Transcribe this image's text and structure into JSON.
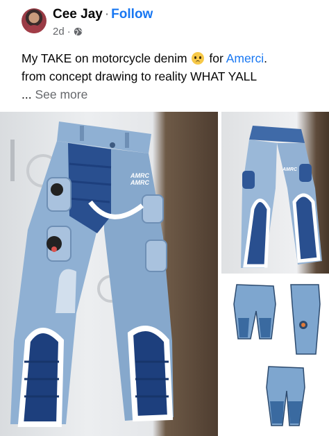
{
  "post": {
    "author": "Cee Jay",
    "separator": "·",
    "follow_label": "Follow",
    "time": "2d",
    "privacy_separator": "·",
    "privacy_icon": "globe-icon",
    "caption_line1_start": "My TAKE on motorcycle denim",
    "caption_emoji": "pleading-face-emoji",
    "caption_line1_mid": "for",
    "caption_link": "Amerci",
    "caption_line1_end": ".",
    "caption_line2": "from concept drawing to reality WHAT YALL",
    "caption_ellipsis": "...",
    "see_more_label": "See more"
  },
  "photos": {
    "main_label_text": "AMRC",
    "side_label_text": "AMRC"
  },
  "colors": {
    "link": "#1877f2",
    "muted": "#65676b",
    "denim_light": "#8fb0d3",
    "denim_dark": "#294f8f",
    "denim_navy": "#1d3f7d"
  }
}
